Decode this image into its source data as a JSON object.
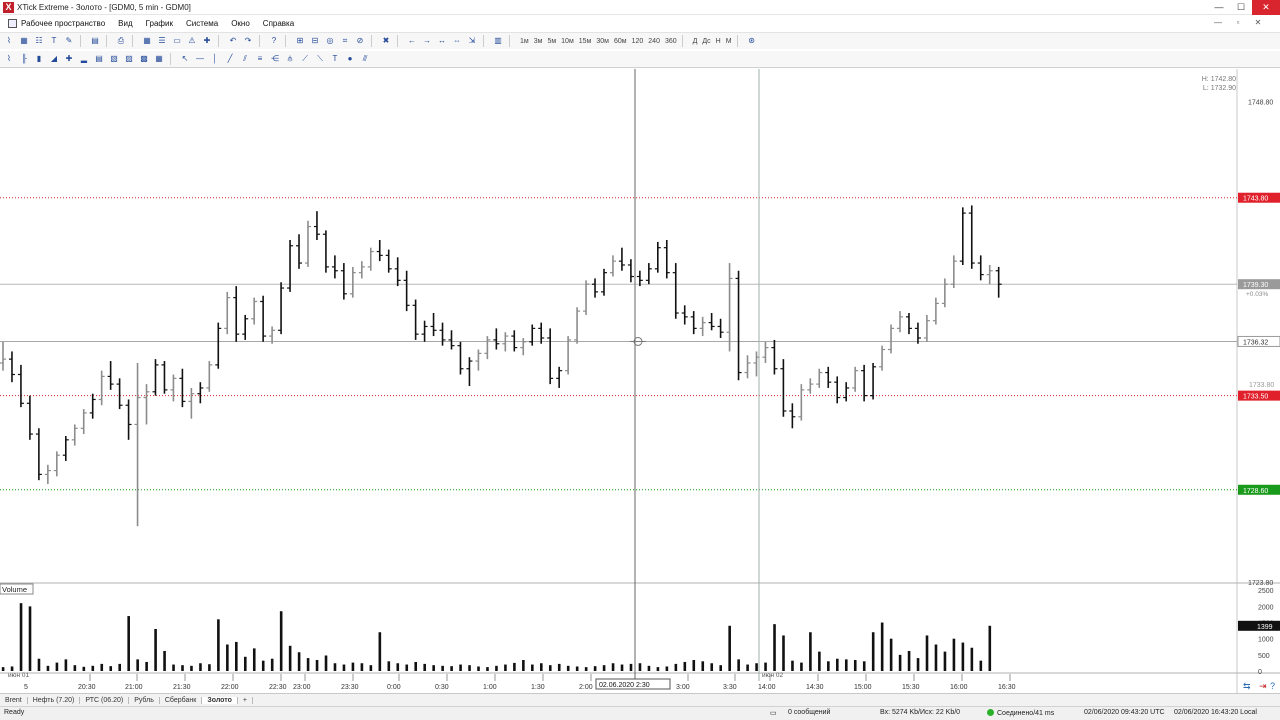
{
  "window": {
    "title": "XTick Extreme - Золото - [GDM0, 5 min - GDM0]",
    "app_icon": "X",
    "min": "—",
    "max": "☐",
    "close": "✕"
  },
  "menu": {
    "items": [
      "Рабочее пространство",
      "Вид",
      "График",
      "Система",
      "Окно",
      "Справка"
    ],
    "mdi_min": "—",
    "mdi_max": "▫",
    "mdi_close": "✕"
  },
  "toolbar": {
    "timeframes": [
      "1м",
      "3м",
      "5м",
      "10м",
      "15м",
      "30м",
      "60м",
      "120",
      "240",
      "360"
    ],
    "periods": [
      "Д",
      "Дс",
      "Н",
      "М"
    ]
  },
  "chart": {
    "hl_high": "H: 1742.80",
    "hl_low": "L: 1732.90",
    "price_labels": [
      "1748.80",
      "1723.80"
    ],
    "levels": [
      {
        "value": "1743.80",
        "color": "#e0202a",
        "style": "dotted"
      },
      {
        "value": "1733.50",
        "color": "#e0202a",
        "style": "dotted"
      },
      {
        "value": "1728.60",
        "color": "#1a9a1a",
        "style": "dotted"
      },
      {
        "value": "1736.32",
        "color": "#a8a8a8",
        "style": "solid"
      }
    ],
    "current_price": "1739.30",
    "current_change": "+0.03%",
    "overlap_label": "1733.80",
    "volume_label": "Volume",
    "volume_axis": [
      "2500",
      "2000",
      "1500",
      "1000",
      "500",
      "0"
    ],
    "volume_current": "1399",
    "crosshair_date": "02.06.2020  2:30",
    "day_labels": [
      "июн 01",
      "июн 02"
    ],
    "time_labels": [
      "20:30",
      "21:00",
      "21:30",
      "22:00",
      "22:30",
      "23:00",
      "23:30",
      "0:00",
      "0:30",
      "1:00",
      "1:30",
      "2:00",
      "3:00",
      "3:30",
      "14:00",
      "14:30",
      "15:00",
      "15:30",
      "16:00",
      "16:30"
    ],
    "first_tick": "5"
  },
  "tabs": [
    "Brent",
    "Нефть (7.20)",
    "РТС (06.20)",
    "Рубль",
    "Сбербанк",
    "Золото",
    "+"
  ],
  "active_tab": "Золото",
  "status": {
    "ready": "Ready",
    "messages": "0 сообщений",
    "traffic": "Вх: 5274 Kb/Исх: 22 Kb/0",
    "connected": "Соединено/41 ms",
    "utc": "02/06/2020 09:43:20 UTC",
    "local": "02/06/2020 16:43:20 Local"
  },
  "chart_data": {
    "type": "ohlc",
    "price_range": [
      1723.8,
      1750.5
    ],
    "bars": [
      [
        1735.2,
        1736.3,
        1734.8,
        1735.4
      ],
      [
        1735.4,
        1735.8,
        1734.2,
        1734.6
      ],
      [
        1734.6,
        1735.1,
        1732.9,
        1733.1
      ],
      [
        1733.1,
        1733.5,
        1731.2,
        1731.5
      ],
      [
        1731.5,
        1731.8,
        1729.1,
        1729.4
      ],
      [
        1729.4,
        1729.9,
        1728.9,
        1729.6
      ],
      [
        1729.6,
        1730.6,
        1729.3,
        1730.4
      ],
      [
        1730.4,
        1731.4,
        1730.1,
        1731.2
      ],
      [
        1731.2,
        1732.0,
        1730.9,
        1731.8
      ],
      [
        1731.8,
        1732.8,
        1731.5,
        1732.6
      ],
      [
        1732.6,
        1733.6,
        1732.3,
        1733.3
      ],
      [
        1733.3,
        1734.8,
        1733.0,
        1734.5
      ],
      [
        1734.5,
        1735.3,
        1733.8,
        1734.1
      ],
      [
        1734.1,
        1734.4,
        1732.8,
        1733.0
      ],
      [
        1733.0,
        1733.3,
        1731.2,
        1732.0
      ],
      [
        1732.0,
        1735.2,
        1726.7,
        1733.4
      ],
      [
        1733.4,
        1734.1,
        1732.0,
        1733.7
      ],
      [
        1733.7,
        1735.4,
        1733.5,
        1735.1
      ],
      [
        1735.1,
        1735.3,
        1733.6,
        1733.8
      ],
      [
        1733.8,
        1734.6,
        1733.2,
        1734.4
      ],
      [
        1734.4,
        1734.9,
        1732.9,
        1733.2
      ],
      [
        1733.2,
        1733.9,
        1732.3,
        1733.6
      ],
      [
        1733.6,
        1734.2,
        1733.1,
        1733.9
      ],
      [
        1733.9,
        1735.3,
        1733.7,
        1735.1
      ],
      [
        1735.1,
        1737.3,
        1734.9,
        1737.0
      ],
      [
        1737.0,
        1738.9,
        1736.7,
        1738.6
      ],
      [
        1738.6,
        1739.2,
        1736.3,
        1736.7
      ],
      [
        1736.7,
        1737.7,
        1736.4,
        1737.5
      ],
      [
        1737.5,
        1738.6,
        1737.2,
        1738.4
      ],
      [
        1738.4,
        1738.7,
        1736.3,
        1736.6
      ],
      [
        1736.6,
        1737.1,
        1736.2,
        1736.9
      ],
      [
        1736.9,
        1739.4,
        1736.7,
        1739.1
      ],
      [
        1739.1,
        1741.6,
        1738.9,
        1741.3
      ],
      [
        1741.3,
        1741.9,
        1740.1,
        1740.4
      ],
      [
        1740.4,
        1742.6,
        1740.2,
        1742.3
      ],
      [
        1742.3,
        1743.1,
        1741.6,
        1741.9
      ],
      [
        1741.9,
        1742.1,
        1739.9,
        1740.2
      ],
      [
        1740.2,
        1740.8,
        1739.6,
        1740.0
      ],
      [
        1740.0,
        1740.4,
        1738.5,
        1738.8
      ],
      [
        1738.8,
        1740.2,
        1738.6,
        1739.9
      ],
      [
        1739.9,
        1740.5,
        1739.6,
        1740.2
      ],
      [
        1740.2,
        1741.2,
        1740.0,
        1741.0
      ],
      [
        1741.0,
        1741.6,
        1740.5,
        1740.8
      ],
      [
        1740.8,
        1741.1,
        1739.9,
        1740.1
      ],
      [
        1740.1,
        1740.7,
        1739.2,
        1739.5
      ],
      [
        1739.5,
        1740.0,
        1737.9,
        1738.2
      ],
      [
        1738.2,
        1738.5,
        1736.4,
        1736.7
      ],
      [
        1736.7,
        1737.4,
        1736.3,
        1737.1
      ],
      [
        1737.1,
        1737.8,
        1736.6,
        1736.9
      ],
      [
        1736.9,
        1737.3,
        1736.1,
        1736.4
      ],
      [
        1736.4,
        1736.9,
        1735.9,
        1736.1
      ],
      [
        1736.1,
        1736.3,
        1734.6,
        1734.9
      ],
      [
        1734.9,
        1735.5,
        1734.0,
        1735.3
      ],
      [
        1735.3,
        1735.9,
        1734.8,
        1735.7
      ],
      [
        1735.7,
        1736.6,
        1735.4,
        1736.4
      ],
      [
        1736.4,
        1737.0,
        1735.9,
        1736.2
      ],
      [
        1736.2,
        1736.8,
        1735.8,
        1736.6
      ],
      [
        1736.6,
        1736.9,
        1735.8,
        1736.0
      ],
      [
        1736.0,
        1736.5,
        1735.6,
        1736.3
      ],
      [
        1736.3,
        1737.2,
        1736.1,
        1737.0
      ],
      [
        1737.0,
        1737.3,
        1736.2,
        1736.5
      ],
      [
        1736.5,
        1737.0,
        1734.1,
        1734.4
      ],
      [
        1734.4,
        1735.0,
        1733.9,
        1734.8
      ],
      [
        1734.8,
        1736.6,
        1734.6,
        1736.4
      ],
      [
        1736.4,
        1738.1,
        1736.2,
        1737.9
      ],
      [
        1737.9,
        1739.5,
        1737.7,
        1739.3
      ],
      [
        1739.3,
        1739.6,
        1738.6,
        1738.9
      ],
      [
        1738.9,
        1740.1,
        1738.7,
        1739.9
      ],
      [
        1739.9,
        1740.8,
        1739.7,
        1740.5
      ],
      [
        1740.5,
        1741.2,
        1740.0,
        1740.3
      ],
      [
        1740.3,
        1740.6,
        1739.4,
        1739.7
      ],
      [
        1739.7,
        1740.0,
        1739.2,
        1739.5
      ],
      [
        1739.5,
        1740.4,
        1739.3,
        1740.1
      ],
      [
        1740.1,
        1741.5,
        1739.9,
        1741.2
      ],
      [
        1741.2,
        1741.6,
        1739.6,
        1739.9
      ],
      [
        1739.9,
        1740.4,
        1737.5,
        1737.8
      ],
      [
        1737.8,
        1738.2,
        1737.2,
        1737.6
      ],
      [
        1737.6,
        1737.9,
        1736.7,
        1737.0
      ],
      [
        1737.0,
        1737.6,
        1736.6,
        1737.3
      ],
      [
        1737.3,
        1737.8,
        1736.9,
        1737.1
      ],
      [
        1737.1,
        1737.5,
        1736.5,
        1736.8
      ],
      [
        1736.8,
        1740.4,
        1735.8,
        1739.6
      ],
      [
        1739.6,
        1740.0,
        1734.3,
        1734.7
      ],
      [
        1734.7,
        1735.6,
        1734.4,
        1735.2
      ],
      [
        1735.2,
        1735.8,
        1734.5,
        1735.5
      ],
      [
        1735.5,
        1736.3,
        1735.2,
        1736.0
      ],
      [
        1736.0,
        1736.4,
        1734.6,
        1734.9
      ],
      [
        1734.9,
        1735.4,
        1732.4,
        1732.7
      ],
      [
        1732.7,
        1733.1,
        1731.8,
        1732.4
      ],
      [
        1732.4,
        1734.1,
        1732.2,
        1733.8
      ],
      [
        1733.8,
        1734.4,
        1733.6,
        1734.1
      ],
      [
        1734.1,
        1734.9,
        1733.9,
        1734.7
      ],
      [
        1734.7,
        1735.0,
        1733.9,
        1734.2
      ],
      [
        1734.2,
        1734.5,
        1733.1,
        1733.4
      ],
      [
        1733.4,
        1734.2,
        1733.2,
        1733.9
      ],
      [
        1733.9,
        1735.0,
        1733.7,
        1734.8
      ],
      [
        1734.8,
        1735.1,
        1733.2,
        1733.5
      ],
      [
        1733.5,
        1735.2,
        1733.3,
        1735.0
      ],
      [
        1735.0,
        1736.1,
        1734.8,
        1735.9
      ],
      [
        1735.9,
        1737.2,
        1735.7,
        1737.0
      ],
      [
        1737.0,
        1737.9,
        1736.8,
        1737.6
      ],
      [
        1737.6,
        1737.8,
        1736.7,
        1737.0
      ],
      [
        1737.0,
        1737.3,
        1736.2,
        1736.5
      ],
      [
        1736.5,
        1737.7,
        1736.3,
        1737.4
      ],
      [
        1737.4,
        1738.6,
        1737.2,
        1738.3
      ],
      [
        1738.3,
        1739.6,
        1738.1,
        1739.3
      ],
      [
        1739.3,
        1740.8,
        1739.1,
        1740.5
      ],
      [
        1740.5,
        1743.3,
        1740.3,
        1743.0
      ],
      [
        1743.0,
        1743.4,
        1740.1,
        1740.4
      ],
      [
        1740.4,
        1740.8,
        1739.5,
        1739.8
      ],
      [
        1739.8,
        1740.3,
        1739.3,
        1740.0
      ],
      [
        1740.0,
        1740.2,
        1738.6,
        1739.3
      ]
    ],
    "volume": [
      120,
      140,
      2100,
      2000,
      380,
      160,
      260,
      360,
      180,
      130,
      160,
      220,
      150,
      220,
      1700,
      360,
      280,
      1300,
      620,
      200,
      180,
      160,
      240,
      210,
      1600,
      820,
      900,
      440,
      700,
      320,
      380,
      1850,
      780,
      580,
      400,
      340,
      480,
      240,
      200,
      260,
      240,
      180,
      1200,
      300,
      240,
      200,
      280,
      220,
      180,
      160,
      150,
      200,
      180,
      140,
      120,
      160,
      200,
      250,
      340,
      200,
      240,
      180,
      220,
      160,
      140,
      120,
      150,
      180,
      240,
      200,
      220,
      240,
      160,
      120,
      140,
      220,
      280,
      340,
      300,
      240,
      180,
      1400,
      360,
      200,
      240,
      260,
      1450,
      1100,
      320,
      260,
      1200,
      600,
      300,
      380,
      360,
      340,
      300,
      1200,
      1500,
      1000,
      500,
      620,
      400,
      1100,
      820,
      600,
      1000,
      880,
      720,
      320,
      1400
    ]
  }
}
